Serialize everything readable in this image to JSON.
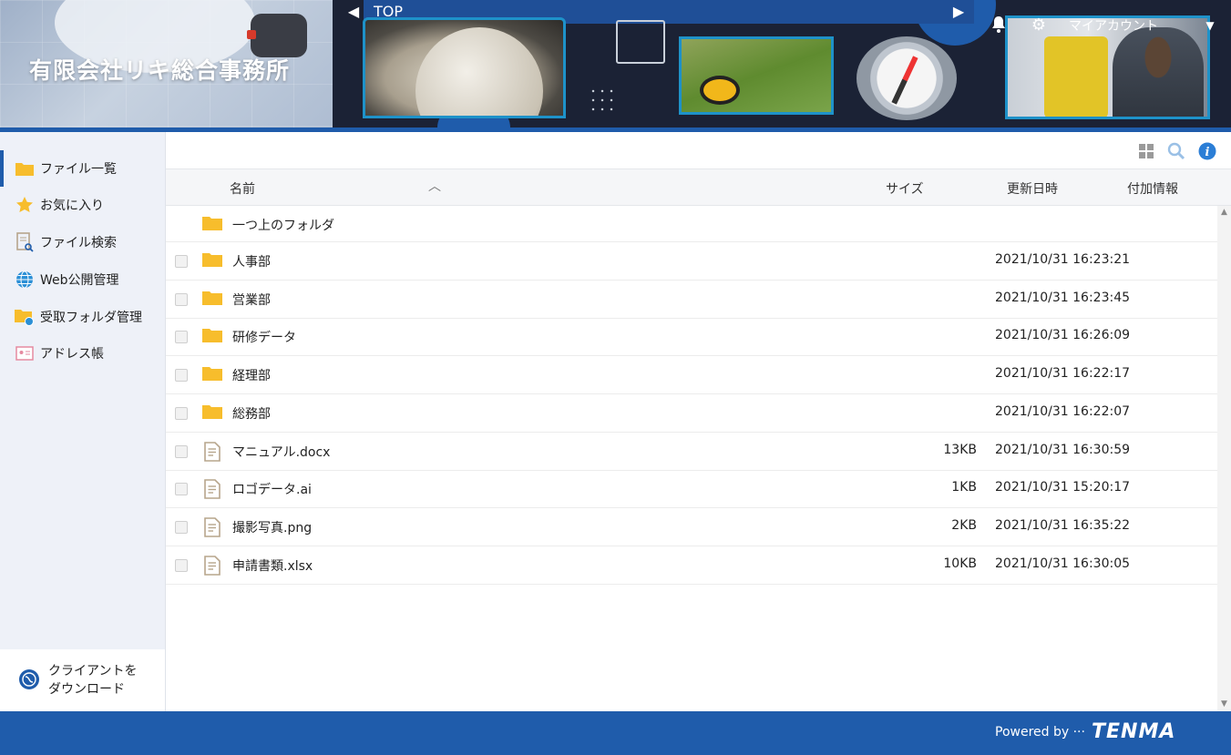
{
  "header": {
    "company_name": "有限会社リキ総合事務所",
    "breadcrumb": "TOP",
    "account_label": "マイアカウント"
  },
  "sidebar": {
    "items": [
      {
        "label": "ファイル一覧",
        "icon": "folder-icon"
      },
      {
        "label": "お気に入り",
        "icon": "star-icon"
      },
      {
        "label": "ファイル検索",
        "icon": "file-search-icon"
      },
      {
        "label": "Web公開管理",
        "icon": "globe-icon"
      },
      {
        "label": "受取フォルダ管理",
        "icon": "receive-folder-icon"
      },
      {
        "label": "アドレス帳",
        "icon": "address-book-icon"
      }
    ],
    "client_download": {
      "line1": "クライアントを",
      "line2": "ダウンロード"
    }
  },
  "table": {
    "headers": {
      "name": "名前",
      "size": "サイズ",
      "date": "更新日時",
      "info": "付加情報"
    },
    "parent_folder": "一つ上のフォルダ",
    "rows": [
      {
        "name": "人事部",
        "type": "folder",
        "size": "",
        "date": "2021/10/31 16:23:21"
      },
      {
        "name": "営業部",
        "type": "folder",
        "size": "",
        "date": "2021/10/31 16:23:45"
      },
      {
        "name": "研修データ",
        "type": "folder",
        "size": "",
        "date": "2021/10/31 16:26:09"
      },
      {
        "name": "経理部",
        "type": "folder",
        "size": "",
        "date": "2021/10/31 16:22:17"
      },
      {
        "name": "総務部",
        "type": "folder",
        "size": "",
        "date": "2021/10/31 16:22:07"
      },
      {
        "name": "マニュアル.docx",
        "type": "file",
        "size": "13KB",
        "date": "2021/10/31 16:30:59"
      },
      {
        "name": "ロゴデータ.ai",
        "type": "file",
        "size": "1KB",
        "date": "2021/10/31 15:20:17"
      },
      {
        "name": "撮影写真.png",
        "type": "file",
        "size": "2KB",
        "date": "2021/10/31 16:35:22"
      },
      {
        "name": "申請書類.xlsx",
        "type": "file",
        "size": "10KB",
        "date": "2021/10/31 16:30:05"
      }
    ]
  },
  "footer": {
    "powered_by": "Powered by ···",
    "brand": "TENMA"
  },
  "colors": {
    "primary": "#1f5cab",
    "folder": "#f7bd2c",
    "file": "#b7a58c"
  }
}
